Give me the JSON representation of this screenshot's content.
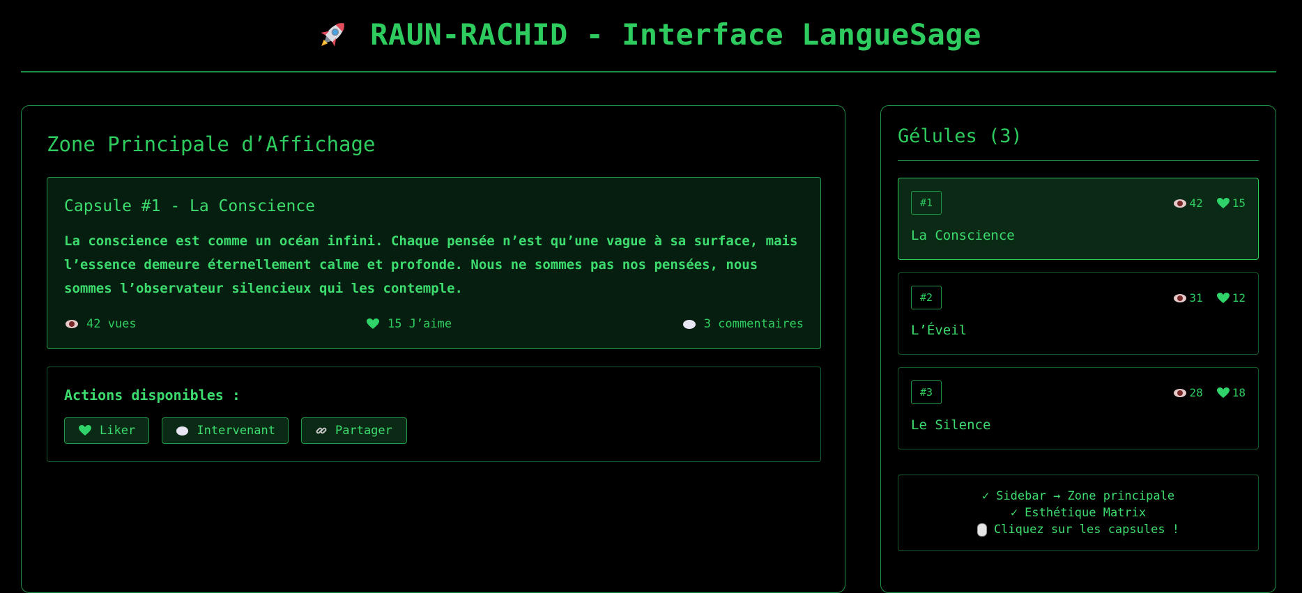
{
  "header": {
    "title": "RAUN-RACHID - Interface LangueSage",
    "icon": "rocket-icon"
  },
  "main": {
    "title": "Zone Principale d’Affichage",
    "capsule": {
      "title": "Capsule #1 - La Conscience",
      "text": "La conscience est comme un océan infini. Chaque pensée n’est qu’une vague à sa surface, mais l’essence demeure éternellement calme et profonde. Nous ne sommes pas nos pensées, nous sommes l’observateur silencieux qui les contemple.",
      "views": "42 vues",
      "likes": "15 J’aime",
      "comments": "3 commentaires"
    },
    "actions": {
      "label": "Actions disponibles :",
      "like_label": "Liker",
      "comment_label": "Intervenant",
      "share_label": "Partager"
    }
  },
  "sidebar": {
    "title": "Gélules (3)",
    "items": [
      {
        "num": "#1",
        "name": "La Conscience",
        "views": "42",
        "likes": "15"
      },
      {
        "num": "#2",
        "name": "L’Éveil",
        "views": "31",
        "likes": "12"
      },
      {
        "num": "#3",
        "name": "Le Silence",
        "views": "28",
        "likes": "18"
      }
    ],
    "info": {
      "line1": "Sidebar → Zone principale",
      "line2": "Esthétique Matrix",
      "line3": "Cliquez sur les capsules !"
    }
  },
  "colors": {
    "background": "#000000",
    "accent": "#2ecc5f",
    "active_bg": "#0a2a15"
  }
}
